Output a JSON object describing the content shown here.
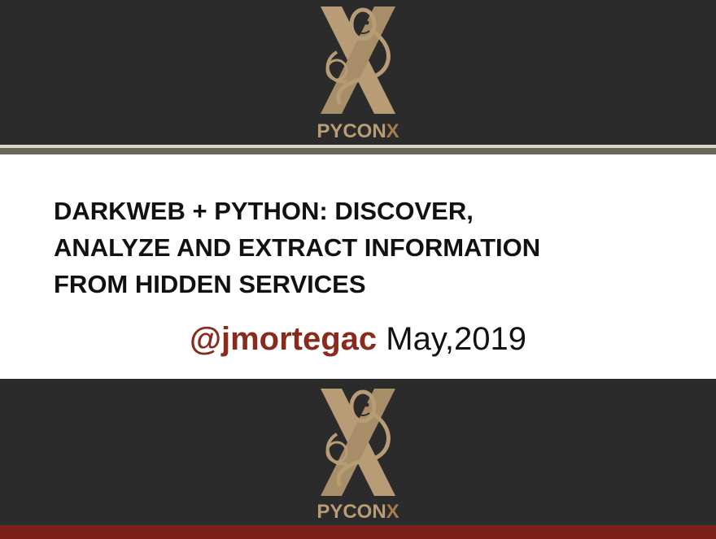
{
  "slide": {
    "title_lines": [
      "DARKWEB + PYTHON: DISCOVER,",
      "ANALYZE AND EXTRACT INFORMATION",
      "FROM HIDDEN SERVICES"
    ],
    "handle": "@jmortegac",
    "date": "May,2019"
  },
  "logo": {
    "word_left": "PYCON",
    "word_right": "X",
    "icon": "pyconx-snake-x-logo"
  },
  "colors": {
    "band": "#2b2b2b",
    "logo_gold": "#b79c75",
    "accent_red": "#8a2a1c",
    "bottom_strip": "#7a1f1a"
  }
}
